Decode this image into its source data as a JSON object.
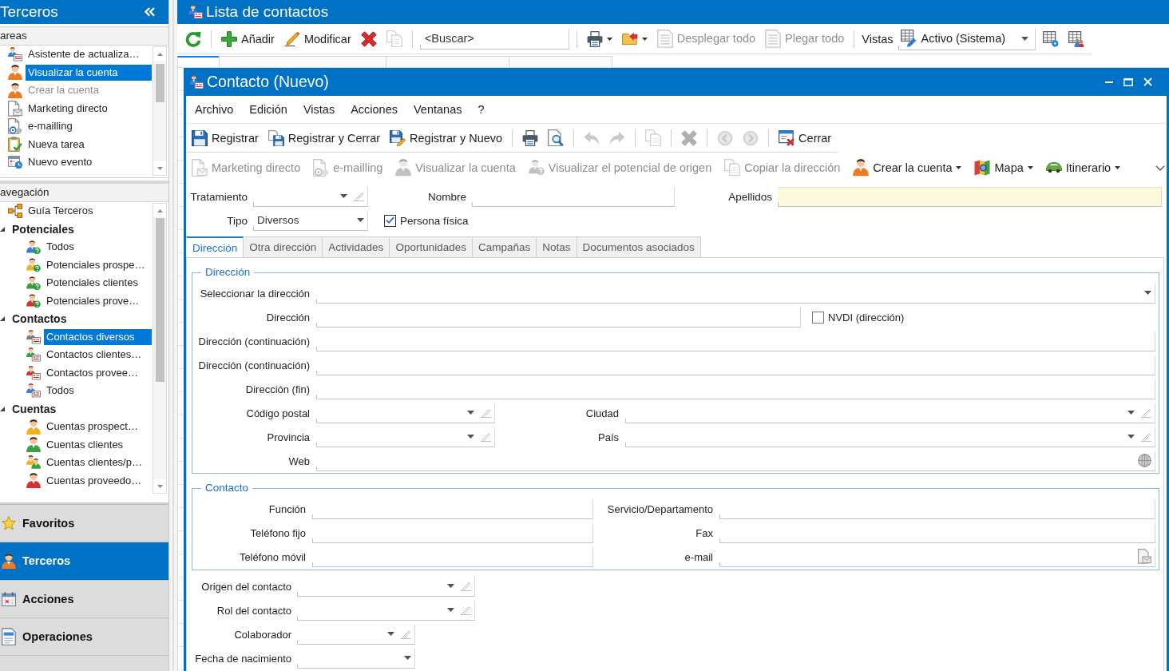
{
  "sidebar": {
    "title": "Terceros",
    "tasks": {
      "header": "areas",
      "items": [
        {
          "label": "Asistente de actualiza…",
          "selected": false,
          "disabled": false
        },
        {
          "label": "Visualizar la cuenta",
          "selected": true,
          "disabled": false
        },
        {
          "label": "Crear la cuenta",
          "selected": false,
          "disabled": true
        },
        {
          "label": "Marketing directo",
          "selected": false,
          "disabled": false
        },
        {
          "label": "e-mailling",
          "selected": false,
          "disabled": false
        },
        {
          "label": "Nueva tarea",
          "selected": false,
          "disabled": false
        },
        {
          "label": "Nuevo evento",
          "selected": false,
          "disabled": false
        }
      ]
    },
    "navigation": {
      "header": "avegación",
      "tree": [
        {
          "label": "Guía Terceros",
          "selected": false
        },
        {
          "label": "Potenciales",
          "selected": false,
          "expanded": true,
          "children": [
            {
              "label": "Todos",
              "selected": false
            },
            {
              "label": "Potenciales prospe…",
              "selected": false
            },
            {
              "label": "Potenciales clientes",
              "selected": false
            },
            {
              "label": "Potenciales prove…",
              "selected": false
            }
          ]
        },
        {
          "label": "Contactos",
          "selected": false,
          "expanded": true,
          "children": [
            {
              "label": "Contactos diversos",
              "selected": true
            },
            {
              "label": "Contactos clientes…",
              "selected": false
            },
            {
              "label": "Contactos provee…",
              "selected": false
            },
            {
              "label": "Todos",
              "selected": false
            }
          ]
        },
        {
          "label": "Cuentas",
          "selected": false,
          "expanded": true,
          "children": [
            {
              "label": "Cuentas prospect…",
              "selected": false
            },
            {
              "label": "Cuentas clientes",
              "selected": false
            },
            {
              "label": "Cuentas clientes/p…",
              "selected": false
            },
            {
              "label": "Cuentas proveedo…",
              "selected": false
            }
          ]
        }
      ]
    },
    "sections": [
      {
        "label": "Favoritos",
        "selected": false
      },
      {
        "label": "Terceros",
        "selected": true
      },
      {
        "label": "Acciones",
        "selected": false
      },
      {
        "label": "Operaciones",
        "selected": false
      }
    ]
  },
  "list_window": {
    "title": "Lista de contactos",
    "toolbar": [
      [
        {
          "kind": "button",
          "disabled": false
        }
      ],
      [
        {
          "kind": "button",
          "label": "Añadir",
          "disabled": false
        },
        {
          "kind": "button",
          "label": "Modificar",
          "disabled": false
        },
        {
          "kind": "button",
          "disabled": false
        },
        {
          "kind": "button",
          "disabled": true
        }
      ],
      [
        {
          "kind": "search",
          "placeholder": "<Buscar>"
        }
      ],
      [
        {
          "kind": "dropdown",
          "disabled": false
        },
        {
          "kind": "dropdown",
          "disabled": false
        },
        {
          "kind": "button",
          "label": "Desplegar todo",
          "disabled": true
        },
        {
          "kind": "button",
          "label": "Plegar todo",
          "disabled": true
        }
      ],
      [
        {
          "kind": "label",
          "label": "Vistas"
        },
        {
          "kind": "select",
          "value": "Activo (Sistema)"
        },
        {
          "kind": "button",
          "disabled": false
        },
        {
          "kind": "button",
          "disabled": false
        }
      ]
    ]
  },
  "contact_window": {
    "title": "Contacto (Nuevo)",
    "menu": [
      "Archivo",
      "Edición",
      "Vistas",
      "Acciones",
      "Ventanas",
      "?"
    ],
    "toolbar": [
      [
        {
          "kind": "button",
          "label": "Registrar",
          "disabled": false
        },
        {
          "kind": "button",
          "label": "Registrar y Cerrar",
          "disabled": false
        },
        {
          "kind": "button",
          "label": "Registrar y Nuevo",
          "disabled": false
        }
      ],
      [
        {
          "kind": "button",
          "disabled": false
        },
        {
          "kind": "button",
          "disabled": false
        }
      ],
      [
        {
          "kind": "button",
          "disabled": true
        },
        {
          "kind": "button",
          "disabled": true
        }
      ],
      [
        {
          "kind": "button",
          "disabled": true
        }
      ],
      [
        {
          "kind": "button",
          "disabled": true
        }
      ],
      [
        {
          "kind": "button",
          "disabled": true
        },
        {
          "kind": "button",
          "disabled": true
        }
      ],
      [
        {
          "kind": "button",
          "label": "Cerrar",
          "disabled": false
        }
      ]
    ],
    "action_bar": [
      [
        {
          "kind": "button",
          "label": "Marketing directo",
          "disabled": true
        },
        {
          "kind": "button",
          "label": "e-mailling",
          "disabled": true
        },
        {
          "kind": "button",
          "label": "Visualizar la cuenta",
          "disabled": true
        },
        {
          "kind": "button",
          "label": "Visualizar el potencial de origen",
          "disabled": true
        },
        {
          "kind": "button",
          "label": "Copiar la dirección",
          "disabled": true
        },
        {
          "kind": "dropdown",
          "label": "Crear la cuenta",
          "disabled": false
        },
        {
          "kind": "dropdown",
          "label": "Mapa",
          "disabled": false
        },
        {
          "kind": "dropdown",
          "label": "Itinerario",
          "disabled": false
        }
      ]
    ],
    "header": {
      "rows": [
        {
          "fields": [
            {
              "label": "Tratamiento",
              "kind": "combo_edit",
              "required": false
            },
            {
              "label": "Nombre",
              "kind": "text",
              "required": false
            },
            {
              "label": "Apellidos",
              "kind": "text",
              "required": true
            }
          ]
        },
        {
          "fields": [
            {
              "label": "Tipo",
              "kind": "combo",
              "value": "Diversos",
              "required": false
            }
          ],
          "checkbox": {
            "label": "Persona física",
            "checked": true
          }
        }
      ]
    },
    "tabs": [
      {
        "label": "Dirección",
        "selected": true
      },
      {
        "label": "Otra dirección",
        "selected": false
      },
      {
        "label": "Actividades",
        "selected": false
      },
      {
        "label": "Oportunidades",
        "selected": false
      },
      {
        "label": "Campañas",
        "selected": false
      },
      {
        "label": "Notas",
        "selected": false
      },
      {
        "label": "Documentos asociados",
        "selected": false
      }
    ],
    "address_group": {
      "title": "Dirección",
      "rows": [
        {
          "fields": [
            {
              "label": "Seleccionar la dirección",
              "kind": "combo"
            }
          ]
        },
        {
          "fields": [
            {
              "label": "Dirección",
              "kind": "text"
            }
          ],
          "checkbox": {
            "label": "NVDI (dirección)",
            "checked": false
          }
        },
        {
          "fields": [
            {
              "label": "Dirección (continuación)",
              "kind": "text"
            }
          ]
        },
        {
          "fields": [
            {
              "label": "Dirección (continuación)",
              "kind": "text"
            }
          ]
        },
        {
          "fields": [
            {
              "label": "Dirección (fin)",
              "kind": "text"
            }
          ]
        },
        {
          "fields": [
            {
              "label": "Código postal",
              "kind": "combo_edit"
            },
            {
              "label": "Ciudad",
              "kind": "combo_edit"
            }
          ]
        },
        {
          "fields": [
            {
              "label": "Provincia",
              "kind": "combo_edit"
            },
            {
              "label": "País",
              "kind": "combo_edit"
            }
          ]
        },
        {
          "fields": [
            {
              "label": "Web",
              "kind": "web"
            }
          ]
        }
      ]
    },
    "contact_group": {
      "title": "Contacto",
      "rows": [
        {
          "fields": [
            {
              "label": "Función",
              "kind": "text"
            },
            {
              "label": "Servicio/Departamento",
              "kind": "text"
            }
          ]
        },
        {
          "fields": [
            {
              "label": "Teléfono fijo",
              "kind": "text"
            },
            {
              "label": "Fax",
              "kind": "text"
            }
          ]
        },
        {
          "fields": [
            {
              "label": "Teléfono móvil",
              "kind": "text"
            },
            {
              "label": "e-mail",
              "kind": "email"
            }
          ]
        }
      ]
    },
    "extra": {
      "rows": [
        {
          "fields": [
            {
              "label": "Origen del contacto",
              "kind": "combo_edit"
            }
          ]
        },
        {
          "fields": [
            {
              "label": "Rol del contacto",
              "kind": "combo_edit"
            }
          ]
        },
        {
          "fields": [
            {
              "label": "Colaborador",
              "kind": "combo_edit"
            }
          ]
        },
        {
          "fields": [
            {
              "label": "Fecha de nacimiento",
              "kind": "combo"
            }
          ]
        }
      ]
    }
  }
}
